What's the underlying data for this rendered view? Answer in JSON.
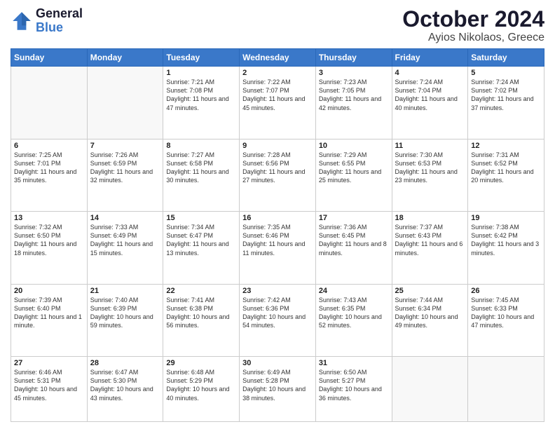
{
  "header": {
    "logo_line1": "General",
    "logo_line2": "Blue",
    "title": "October 2024",
    "subtitle": "Ayios Nikolaos, Greece"
  },
  "calendar": {
    "days_of_week": [
      "Sunday",
      "Monday",
      "Tuesday",
      "Wednesday",
      "Thursday",
      "Friday",
      "Saturday"
    ],
    "weeks": [
      [
        {
          "day": "",
          "sunrise": "",
          "sunset": "",
          "daylight": ""
        },
        {
          "day": "",
          "sunrise": "",
          "sunset": "",
          "daylight": ""
        },
        {
          "day": "1",
          "sunrise": "Sunrise: 7:21 AM",
          "sunset": "Sunset: 7:08 PM",
          "daylight": "Daylight: 11 hours and 47 minutes."
        },
        {
          "day": "2",
          "sunrise": "Sunrise: 7:22 AM",
          "sunset": "Sunset: 7:07 PM",
          "daylight": "Daylight: 11 hours and 45 minutes."
        },
        {
          "day": "3",
          "sunrise": "Sunrise: 7:23 AM",
          "sunset": "Sunset: 7:05 PM",
          "daylight": "Daylight: 11 hours and 42 minutes."
        },
        {
          "day": "4",
          "sunrise": "Sunrise: 7:24 AM",
          "sunset": "Sunset: 7:04 PM",
          "daylight": "Daylight: 11 hours and 40 minutes."
        },
        {
          "day": "5",
          "sunrise": "Sunrise: 7:24 AM",
          "sunset": "Sunset: 7:02 PM",
          "daylight": "Daylight: 11 hours and 37 minutes."
        }
      ],
      [
        {
          "day": "6",
          "sunrise": "Sunrise: 7:25 AM",
          "sunset": "Sunset: 7:01 PM",
          "daylight": "Daylight: 11 hours and 35 minutes."
        },
        {
          "day": "7",
          "sunrise": "Sunrise: 7:26 AM",
          "sunset": "Sunset: 6:59 PM",
          "daylight": "Daylight: 11 hours and 32 minutes."
        },
        {
          "day": "8",
          "sunrise": "Sunrise: 7:27 AM",
          "sunset": "Sunset: 6:58 PM",
          "daylight": "Daylight: 11 hours and 30 minutes."
        },
        {
          "day": "9",
          "sunrise": "Sunrise: 7:28 AM",
          "sunset": "Sunset: 6:56 PM",
          "daylight": "Daylight: 11 hours and 27 minutes."
        },
        {
          "day": "10",
          "sunrise": "Sunrise: 7:29 AM",
          "sunset": "Sunset: 6:55 PM",
          "daylight": "Daylight: 11 hours and 25 minutes."
        },
        {
          "day": "11",
          "sunrise": "Sunrise: 7:30 AM",
          "sunset": "Sunset: 6:53 PM",
          "daylight": "Daylight: 11 hours and 23 minutes."
        },
        {
          "day": "12",
          "sunrise": "Sunrise: 7:31 AM",
          "sunset": "Sunset: 6:52 PM",
          "daylight": "Daylight: 11 hours and 20 minutes."
        }
      ],
      [
        {
          "day": "13",
          "sunrise": "Sunrise: 7:32 AM",
          "sunset": "Sunset: 6:50 PM",
          "daylight": "Daylight: 11 hours and 18 minutes."
        },
        {
          "day": "14",
          "sunrise": "Sunrise: 7:33 AM",
          "sunset": "Sunset: 6:49 PM",
          "daylight": "Daylight: 11 hours and 15 minutes."
        },
        {
          "day": "15",
          "sunrise": "Sunrise: 7:34 AM",
          "sunset": "Sunset: 6:47 PM",
          "daylight": "Daylight: 11 hours and 13 minutes."
        },
        {
          "day": "16",
          "sunrise": "Sunrise: 7:35 AM",
          "sunset": "Sunset: 6:46 PM",
          "daylight": "Daylight: 11 hours and 11 minutes."
        },
        {
          "day": "17",
          "sunrise": "Sunrise: 7:36 AM",
          "sunset": "Sunset: 6:45 PM",
          "daylight": "Daylight: 11 hours and 8 minutes."
        },
        {
          "day": "18",
          "sunrise": "Sunrise: 7:37 AM",
          "sunset": "Sunset: 6:43 PM",
          "daylight": "Daylight: 11 hours and 6 minutes."
        },
        {
          "day": "19",
          "sunrise": "Sunrise: 7:38 AM",
          "sunset": "Sunset: 6:42 PM",
          "daylight": "Daylight: 11 hours and 3 minutes."
        }
      ],
      [
        {
          "day": "20",
          "sunrise": "Sunrise: 7:39 AM",
          "sunset": "Sunset: 6:40 PM",
          "daylight": "Daylight: 11 hours and 1 minute."
        },
        {
          "day": "21",
          "sunrise": "Sunrise: 7:40 AM",
          "sunset": "Sunset: 6:39 PM",
          "daylight": "Daylight: 10 hours and 59 minutes."
        },
        {
          "day": "22",
          "sunrise": "Sunrise: 7:41 AM",
          "sunset": "Sunset: 6:38 PM",
          "daylight": "Daylight: 10 hours and 56 minutes."
        },
        {
          "day": "23",
          "sunrise": "Sunrise: 7:42 AM",
          "sunset": "Sunset: 6:36 PM",
          "daylight": "Daylight: 10 hours and 54 minutes."
        },
        {
          "day": "24",
          "sunrise": "Sunrise: 7:43 AM",
          "sunset": "Sunset: 6:35 PM",
          "daylight": "Daylight: 10 hours and 52 minutes."
        },
        {
          "day": "25",
          "sunrise": "Sunrise: 7:44 AM",
          "sunset": "Sunset: 6:34 PM",
          "daylight": "Daylight: 10 hours and 49 minutes."
        },
        {
          "day": "26",
          "sunrise": "Sunrise: 7:45 AM",
          "sunset": "Sunset: 6:33 PM",
          "daylight": "Daylight: 10 hours and 47 minutes."
        }
      ],
      [
        {
          "day": "27",
          "sunrise": "Sunrise: 6:46 AM",
          "sunset": "Sunset: 5:31 PM",
          "daylight": "Daylight: 10 hours and 45 minutes."
        },
        {
          "day": "28",
          "sunrise": "Sunrise: 6:47 AM",
          "sunset": "Sunset: 5:30 PM",
          "daylight": "Daylight: 10 hours and 43 minutes."
        },
        {
          "day": "29",
          "sunrise": "Sunrise: 6:48 AM",
          "sunset": "Sunset: 5:29 PM",
          "daylight": "Daylight: 10 hours and 40 minutes."
        },
        {
          "day": "30",
          "sunrise": "Sunrise: 6:49 AM",
          "sunset": "Sunset: 5:28 PM",
          "daylight": "Daylight: 10 hours and 38 minutes."
        },
        {
          "day": "31",
          "sunrise": "Sunrise: 6:50 AM",
          "sunset": "Sunset: 5:27 PM",
          "daylight": "Daylight: 10 hours and 36 minutes."
        },
        {
          "day": "",
          "sunrise": "",
          "sunset": "",
          "daylight": ""
        },
        {
          "day": "",
          "sunrise": "",
          "sunset": "",
          "daylight": ""
        }
      ]
    ]
  }
}
